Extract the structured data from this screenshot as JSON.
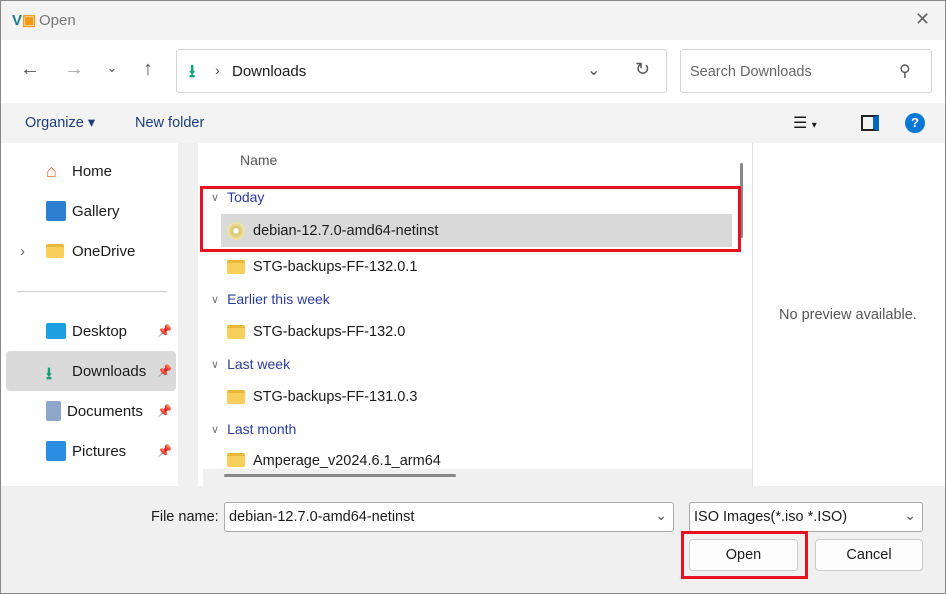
{
  "window": {
    "title": "Open"
  },
  "nav": {
    "path_current": "Downloads",
    "search_placeholder": "Search Downloads"
  },
  "toolbar": {
    "organize": "Organize",
    "new_folder": "New folder"
  },
  "sidebar": {
    "items": [
      {
        "label": "Home"
      },
      {
        "label": "Gallery"
      },
      {
        "label": "OneDrive"
      },
      {
        "label": "Desktop"
      },
      {
        "label": "Downloads"
      },
      {
        "label": "Documents"
      },
      {
        "label": "Pictures"
      }
    ]
  },
  "list": {
    "column_name": "Name",
    "groups": [
      {
        "label": "Today",
        "files": [
          "debian-12.7.0-amd64-netinst",
          "STG-backups-FF-132.0.1"
        ]
      },
      {
        "label": "Earlier this week",
        "files": [
          "STG-backups-FF-132.0"
        ]
      },
      {
        "label": "Last week",
        "files": [
          "STG-backups-FF-131.0.3"
        ]
      },
      {
        "label": "Last month",
        "files": [
          "Amperage_v2024.6.1_arm64"
        ]
      }
    ]
  },
  "preview": {
    "text": "No preview available."
  },
  "footer": {
    "file_name_label": "File name:",
    "file_name_value": "debian-12.7.0-amd64-netinst",
    "file_type": "ISO Images(*.iso *.ISO)",
    "open": "Open",
    "cancel": "Cancel"
  },
  "colors": {
    "highlight": "#e81123",
    "accent": "#0067c0"
  }
}
